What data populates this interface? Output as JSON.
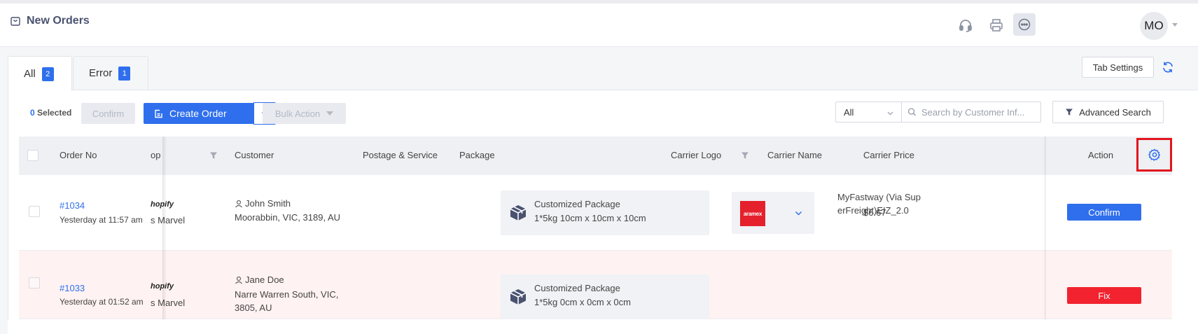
{
  "header": {
    "title": "New Orders",
    "avatar_initials": "MO"
  },
  "tabs": [
    {
      "label": "All",
      "count": "2"
    },
    {
      "label": "Error",
      "count": "1"
    }
  ],
  "toolbar": {
    "selected_count": "0",
    "selected_label": "Selected",
    "confirm_label": "Confirm",
    "create_order_label": "Create Order",
    "bulk_action_label": "Bulk Action",
    "tab_settings_label": "Tab Settings",
    "filter_value": "All",
    "search_placeholder": "Search by Customer Inf...",
    "advanced_search_label": "Advanced Search"
  },
  "table": {
    "columns": {
      "order_no": "Order No",
      "shop": "op",
      "customer": "Customer",
      "postage": "Postage & Service",
      "package": "Package",
      "carrier_logo": "Carrier Logo",
      "carrier_name": "Carrier Name",
      "carrier_price": "Carrier Price",
      "action": "Action"
    },
    "rows": [
      {
        "order_no": "#1034",
        "time": "Yesterday at 11:57 am",
        "shop_platform": "hopify",
        "shop_name": "s Marvel",
        "customer_name": "John Smith",
        "address_line1": "Moorabbin, VIC, 3189, AU",
        "address_line2": "",
        "package_name": "Customized Package",
        "package_dims": "1*5kg   10cm x 10cm x 10cm",
        "carrier_logo_text": "aramex",
        "carrier_name": "MyFastway (Via SuperFreight)EIZ_2.0",
        "carrier_price": "$6.67",
        "action_label": "Confirm"
      },
      {
        "order_no": "#1033",
        "time": "Yesterday at 01:52 am",
        "shop_platform": "hopify",
        "shop_name": "s Marvel",
        "customer_name": "Jane Doe",
        "address_line1": "Narre Warren South, VIC,",
        "address_line2": "3805, AU",
        "package_name": "Customized Package",
        "package_dims": "1*5kg   0cm x 0cm x 0cm",
        "carrier_logo_text": "",
        "carrier_name": "",
        "carrier_price": "",
        "action_label": "Fix"
      }
    ]
  },
  "colors": {
    "primary": "#2f6fed",
    "danger": "#f2222f",
    "error_row": "#fff2f2",
    "highlight": "#e3151e"
  }
}
